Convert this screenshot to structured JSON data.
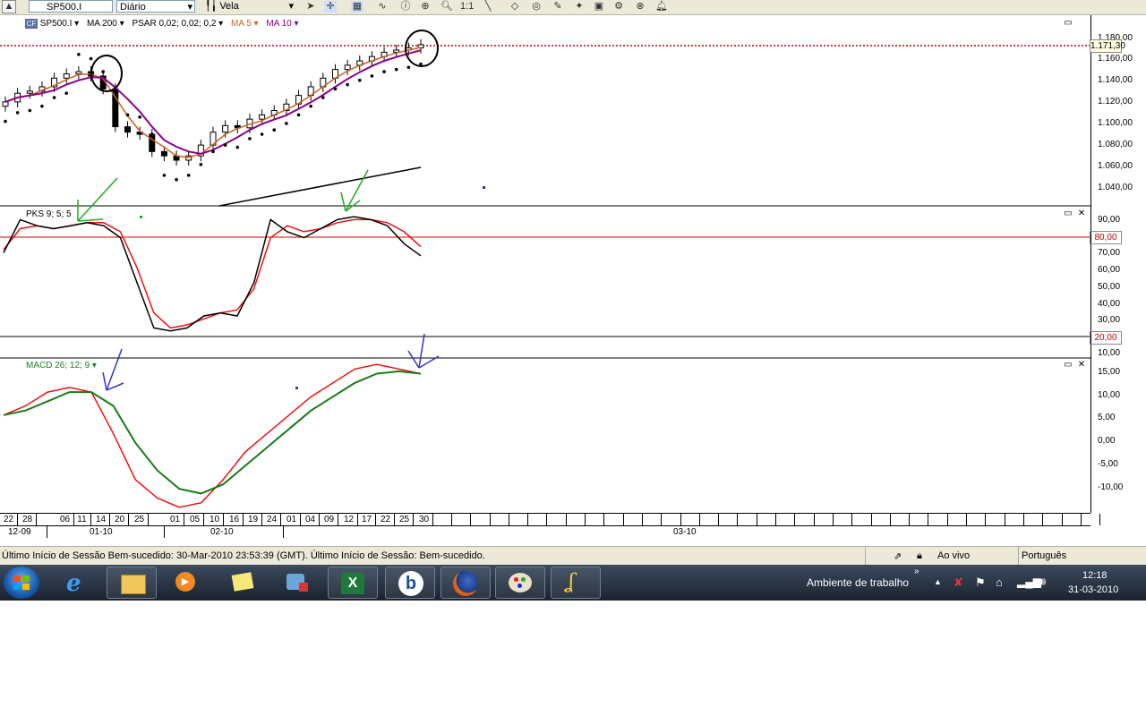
{
  "toolbar": {
    "symbol": "SP500.I",
    "period": "Diário",
    "chart_type": "Vela",
    "icons": [
      "collapse-icon",
      "cursor-icon",
      "crosshair-icon",
      "grid-icon",
      "indicator-icon",
      "info-icon",
      "cursor-chart-icon",
      "zoom-icon",
      "scale-one-icon",
      "line-tool-icon",
      "eraser-icon",
      "shapes-icon",
      "tools-icon",
      "studies-icon",
      "compare-icon",
      "settings-icon",
      "alert-icon"
    ]
  },
  "panels": {
    "price": {
      "legend": [
        "SP500.I",
        "MA 200",
        "PSAR 0,02; 0,02; 0,2",
        "MA 5",
        "MA 10"
      ],
      "legend_colors": [
        "#000000",
        "#000000",
        "#000000",
        "#d2691e",
        "#8b008b"
      ],
      "scale": [
        "1.180,00",
        "1.160,00",
        "1.140,00",
        "1.120,00",
        "1.100,00",
        "1.080,00",
        "1.060,00",
        "1.040,00"
      ],
      "current_price": "1.171,30"
    },
    "pks": {
      "legend": "PKS 9; 5; 5",
      "scale": [
        "90,00",
        "70,00",
        "60,00",
        "50,00",
        "40,00",
        "30,00",
        "10,00"
      ],
      "upper_level": "80,00",
      "lower_level": "20,00"
    },
    "macd": {
      "legend": "MACD 26; 12; 9",
      "scale": [
        "15,00",
        "10,00",
        "5,00",
        "0,00",
        "-5,00",
        "-10,00"
      ]
    }
  },
  "dates": {
    "days": [
      "22",
      "28",
      "06",
      "11",
      "14",
      "20",
      "25",
      "01",
      "05",
      "10",
      "16",
      "19",
      "24",
      "01",
      "04",
      "09",
      "12",
      "17",
      "22",
      "25",
      "30"
    ],
    "months": [
      "12-09",
      "01-10",
      "02-10",
      "03-10"
    ]
  },
  "statusbar": {
    "message": "Último Início de Sessão Bem-sucedido: 30-Mar-2010 23:53:39 (GMT). Último Início de Sessão: Bem-sucedido.",
    "live": "Ao vivo",
    "language": "Português"
  },
  "taskbar": {
    "desktop_label": "Ambiente de trabalho",
    "time": "12:18",
    "date": "31-03-2010",
    "apps": [
      "start-orb-icon",
      "internet-explorer-icon",
      "file-explorer-icon",
      "media-player-icon",
      "sticky-notes-icon",
      "network-app-icon",
      "excel-icon",
      "b-app-icon",
      "firefox-icon",
      "paint-icon",
      "pen-app-icon"
    ]
  },
  "chart_data": [
    {
      "type": "line",
      "title": "",
      "series": [
        {
          "name": "SP500.I",
          "values": [
            1118,
            1126,
            1128,
            1132,
            1140,
            1144,
            1146,
            1142,
            1130,
            1095,
            1090,
            1088,
            1072,
            1068,
            1064,
            1068,
            1078,
            1090,
            1096,
            1094,
            1102,
            1106,
            1110,
            1116,
            1124,
            1132,
            1140,
            1148,
            1152,
            1156,
            1160,
            1164,
            1166,
            1168,
            1171
          ]
        }
      ],
      "ylim": [
        1030,
        1190
      ]
    },
    {
      "type": "line",
      "title": "",
      "series": [
        {
          "name": "PKS 9; 5; 5",
          "values": [
            70,
            92,
            88,
            86,
            88,
            90,
            88,
            80,
            50,
            20,
            18,
            20,
            28,
            30,
            28,
            50,
            92,
            84,
            80,
            86,
            92,
            94,
            92,
            88,
            76,
            68
          ]
        },
        {
          "values": [
            72,
            86,
            88,
            86,
            88,
            90,
            90,
            84,
            60,
            30,
            20,
            22,
            26,
            30,
            32,
            46,
            80,
            88,
            84,
            86,
            90,
            92,
            92,
            90,
            84,
            74
          ]
        }
      ],
      "ylim": [
        0,
        100
      ]
    },
    {
      "type": "line",
      "title": "",
      "series": [
        {
          "name": "MACD 26; 12; 9",
          "values": [
            6,
            8,
            11,
            12,
            11,
            2,
            -8,
            -12,
            -14,
            -13,
            -8,
            -2,
            2,
            6,
            10,
            13,
            16,
            17,
            16,
            15
          ]
        },
        {
          "values": [
            6,
            7,
            9,
            11,
            11,
            8,
            0,
            -6,
            -10,
            -11,
            -9,
            -5,
            -1,
            3,
            7,
            10,
            13,
            15,
            15.5,
            15
          ]
        }
      ],
      "ylim": [
        -15,
        18
      ]
    }
  ]
}
